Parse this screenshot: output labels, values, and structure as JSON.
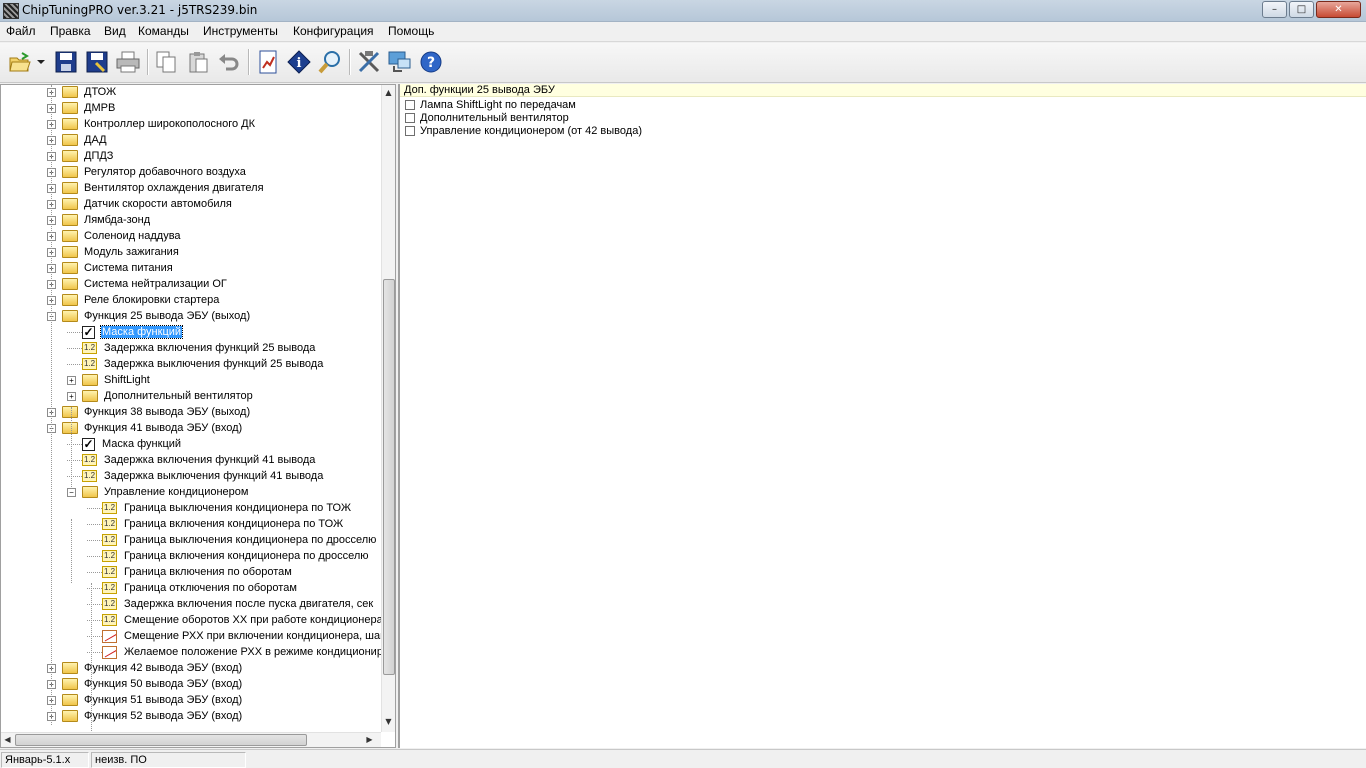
{
  "window": {
    "title": "ChipTuningPRO ver.3.21 - j5TRS239.bin",
    "minimize": "–",
    "maximize": "□",
    "close": "✕"
  },
  "menu": [
    "Файл",
    "Правка",
    "Вид",
    "Команды",
    "Инструменты",
    "Конфигурация",
    "Помощь"
  ],
  "toolbar": {
    "icons": [
      "open-folder-icon",
      "dropdown-arrow-icon",
      "save-icon",
      "save-as-icon",
      "print-icon",
      "copy-icon",
      "paste-icon",
      "undo-icon",
      "compare-icon",
      "info-icon",
      "search-icon",
      "tools-icon",
      "connect-icon",
      "help-icon"
    ],
    "help_glyph": "?",
    "info_glyph": "i"
  },
  "tree": {
    "items": [
      {
        "level": 0,
        "type": "folder",
        "expander": "+",
        "label": "ДТОЖ"
      },
      {
        "level": 0,
        "type": "folder",
        "expander": "+",
        "label": "ДМРВ"
      },
      {
        "level": 0,
        "type": "folder",
        "expander": "+",
        "label": "Контроллер широкополосного ДК"
      },
      {
        "level": 0,
        "type": "folder",
        "expander": "+",
        "label": "ДАД"
      },
      {
        "level": 0,
        "type": "folder",
        "expander": "+",
        "label": "ДПДЗ"
      },
      {
        "level": 0,
        "type": "folder",
        "expander": "+",
        "label": "Регулятор добавочного воздуха"
      },
      {
        "level": 0,
        "type": "folder",
        "expander": "+",
        "label": "Вентилятор охлаждения двигателя"
      },
      {
        "level": 0,
        "type": "folder",
        "expander": "+",
        "label": "Датчик скорости автомобиля"
      },
      {
        "level": 0,
        "type": "folder",
        "expander": "+",
        "label": "Лямбда-зонд"
      },
      {
        "level": 0,
        "type": "folder",
        "expander": "+",
        "label": "Соленоид наддува"
      },
      {
        "level": 0,
        "type": "folder",
        "expander": "+",
        "label": "Модуль зажигания"
      },
      {
        "level": 0,
        "type": "folder",
        "expander": "+",
        "label": "Система питания"
      },
      {
        "level": 0,
        "type": "folder",
        "expander": "+",
        "label": "Система нейтрализации ОГ"
      },
      {
        "level": 0,
        "type": "folder",
        "expander": "+",
        "label": "Реле блокировки стартера"
      },
      {
        "level": 0,
        "type": "folder",
        "expander": "−",
        "label": "Функция 25 вывода ЭБУ (выход)"
      },
      {
        "level": 1,
        "type": "check",
        "expander": "",
        "label": "Маска функций",
        "selected": true
      },
      {
        "level": 1,
        "type": "num",
        "expander": "",
        "label": "Задержка включения функций 25 вывода"
      },
      {
        "level": 1,
        "type": "num",
        "expander": "",
        "label": "Задержка выключения функций 25 вывода"
      },
      {
        "level": 1,
        "type": "folder",
        "expander": "+",
        "label": "ShiftLight"
      },
      {
        "level": 1,
        "type": "folder",
        "expander": "+",
        "label": "Дополнительный вентилятор"
      },
      {
        "level": 0,
        "type": "folder",
        "expander": "+",
        "label": "Функция 38 вывода ЭБУ (выход)"
      },
      {
        "level": 0,
        "type": "folder",
        "expander": "−",
        "label": "Функция 41 вывода ЭБУ (вход)"
      },
      {
        "level": 1,
        "type": "check",
        "expander": "",
        "label": "Маска функций"
      },
      {
        "level": 1,
        "type": "num",
        "expander": "",
        "label": "Задержка включения функций 41 вывода"
      },
      {
        "level": 1,
        "type": "num",
        "expander": "",
        "label": "Задержка выключения функций 41 вывода"
      },
      {
        "level": 1,
        "type": "folder",
        "expander": "−",
        "label": "Управление кондиционером"
      },
      {
        "level": 2,
        "type": "num",
        "expander": "",
        "label": "Граница выключения кондиционера по ТОЖ"
      },
      {
        "level": 2,
        "type": "num",
        "expander": "",
        "label": "Граница включения кондиционера по ТОЖ"
      },
      {
        "level": 2,
        "type": "num",
        "expander": "",
        "label": "Граница выключения кондиционера по дросселю"
      },
      {
        "level": 2,
        "type": "num",
        "expander": "",
        "label": "Граница включения кондиционера по дросселю"
      },
      {
        "level": 2,
        "type": "num",
        "expander": "",
        "label": "Граница включения по оборотам"
      },
      {
        "level": 2,
        "type": "num",
        "expander": "",
        "label": "Граница отключения по оборотам"
      },
      {
        "level": 2,
        "type": "num",
        "expander": "",
        "label": "Задержка включения после пуска двигателя, сек"
      },
      {
        "level": 2,
        "type": "num",
        "expander": "",
        "label": "Смещение оборотов ХХ при работе кондиционера"
      },
      {
        "level": 2,
        "type": "graph",
        "expander": "",
        "label": "Смещение РХХ при включении кондиционера, шаг"
      },
      {
        "level": 2,
        "type": "graph",
        "expander": "",
        "label": "Желаемое положение РХХ в режиме кондиционирования"
      },
      {
        "level": 0,
        "type": "folder",
        "expander": "+",
        "label": "Функция 42 вывода ЭБУ (вход)"
      },
      {
        "level": 0,
        "type": "folder",
        "expander": "+",
        "label": "Функция 50 вывода ЭБУ (вход)"
      },
      {
        "level": 0,
        "type": "folder",
        "expander": "+",
        "label": "Функция 51 вывода ЭБУ (вход)"
      },
      {
        "level": 0,
        "type": "folder",
        "expander": "+",
        "label": "Функция 52 вывода ЭБУ (вход)"
      }
    ],
    "num_glyph": "1.2"
  },
  "right_pane": {
    "header": "Доп. функции 25 вывода ЭБУ",
    "options": [
      {
        "label": "Лампа ShiftLight по передачам",
        "checked": false
      },
      {
        "label": "Дополнительный вентилятор",
        "checked": false
      },
      {
        "label": "Управление кондиционером (от 42 вывода)",
        "checked": false
      }
    ]
  },
  "scroll": {
    "up": "▲",
    "down": "▼",
    "left": "◀",
    "right": "▶"
  },
  "status": {
    "ecu": "Январь-5.1.х",
    "software": "неизв. ПО"
  }
}
